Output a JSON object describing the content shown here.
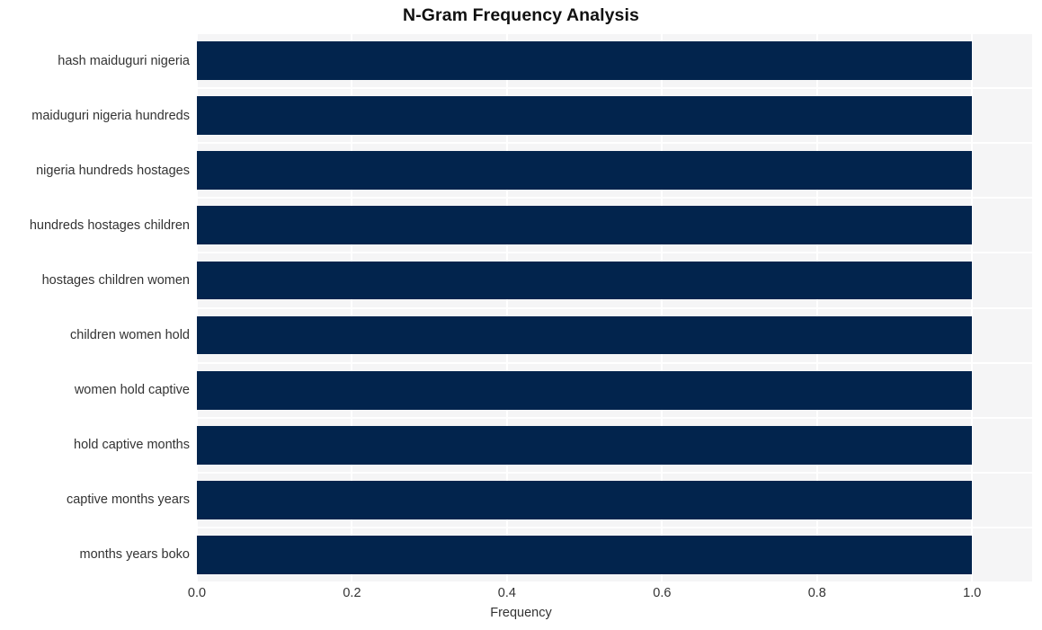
{
  "chart_data": {
    "type": "bar",
    "orientation": "horizontal",
    "title": "N-Gram Frequency Analysis",
    "xlabel": "Frequency",
    "ylabel": "",
    "categories": [
      "hash maiduguri nigeria",
      "maiduguri nigeria hundreds",
      "nigeria hundreds hostages",
      "hundreds hostages children",
      "hostages children women",
      "children women hold",
      "women hold captive",
      "hold captive months",
      "captive months years",
      "months years boko"
    ],
    "values": [
      1.0,
      1.0,
      1.0,
      1.0,
      1.0,
      1.0,
      1.0,
      1.0,
      1.0,
      1.0
    ],
    "xlim": [
      0.0,
      1.0774
    ],
    "xticks": [
      0.0,
      0.2,
      0.4,
      0.6,
      0.8,
      1.0
    ],
    "xticklabels": [
      "0.0",
      "0.2",
      "0.4",
      "0.6",
      "0.8",
      "1.0"
    ],
    "grid": true,
    "grid_color": "#ffffff",
    "legend": null,
    "bar_color": "#02244d",
    "plot_background": "#f5f5f6",
    "figure_background": "#ffffff"
  }
}
